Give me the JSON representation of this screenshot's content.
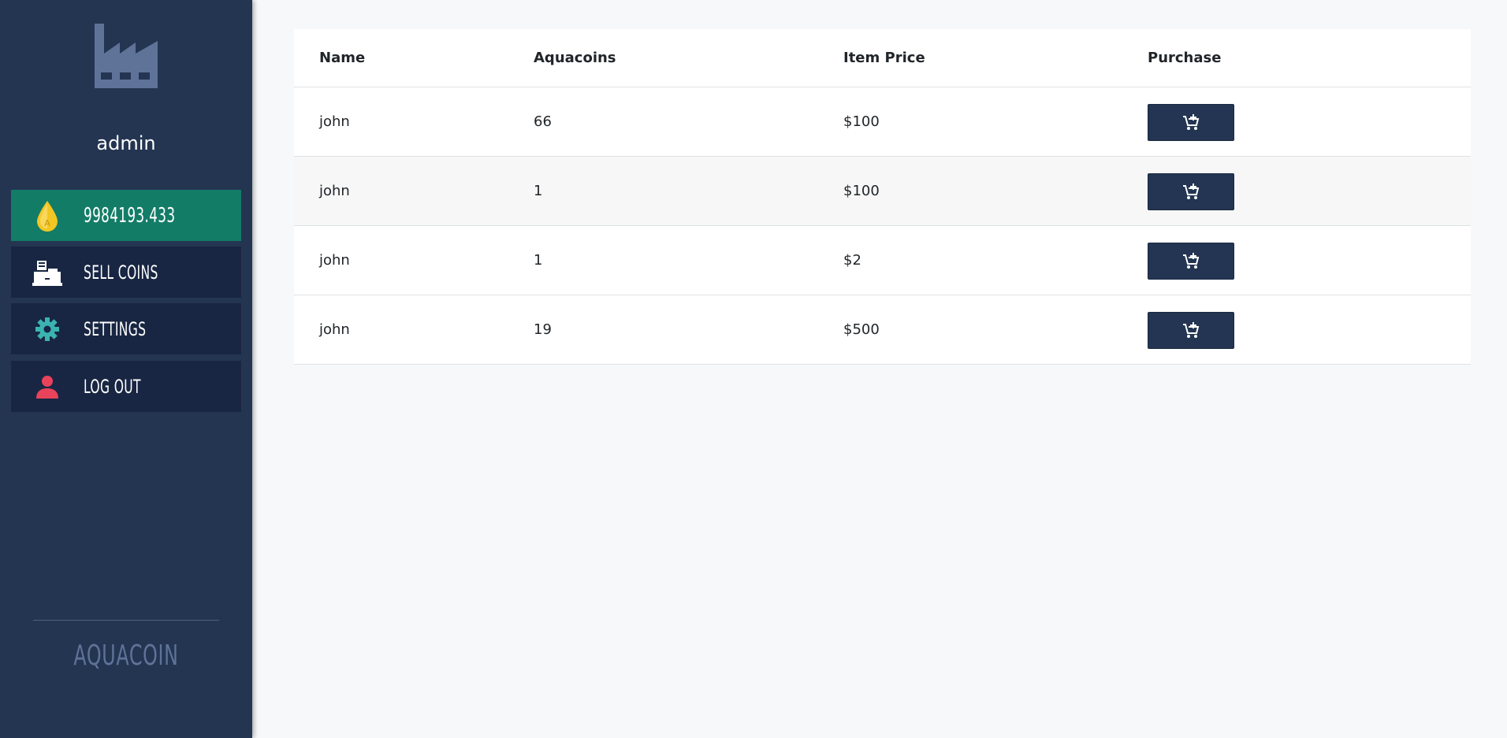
{
  "sidebar": {
    "logo_icon": "factory-icon",
    "username": "admin",
    "items": [
      {
        "id": "balance",
        "icon": "aquacoin-drop-icon",
        "label": "9984193.433",
        "icon_letter": "A"
      },
      {
        "id": "sell-coins",
        "icon": "cash-register-icon",
        "label": "SELL COINS"
      },
      {
        "id": "settings",
        "icon": "gear-icon",
        "label": "SETTINGS"
      },
      {
        "id": "log-out",
        "icon": "user-icon",
        "label": "LOG OUT"
      }
    ],
    "brand": "AQUACOIN"
  },
  "table": {
    "headers": [
      "Name",
      "Aquacoins",
      "Item Price",
      "Purchase"
    ],
    "rows": [
      {
        "name": "john",
        "aquacoins": "66",
        "price": "$100"
      },
      {
        "name": "john",
        "aquacoins": "1",
        "price": "$100"
      },
      {
        "name": "john",
        "aquacoins": "1",
        "price": "$2"
      },
      {
        "name": "john",
        "aquacoins": "19",
        "price": "$500"
      }
    ],
    "purchase_icon": "add-to-cart-icon"
  },
  "colors": {
    "sidebar_bg": "#243552",
    "nav_bg": "#182643",
    "balance_bg": "#137c67",
    "button_bg": "#233552",
    "gear": "#3bb3b0",
    "user": "#e8435a",
    "coin": "#f3c623"
  }
}
